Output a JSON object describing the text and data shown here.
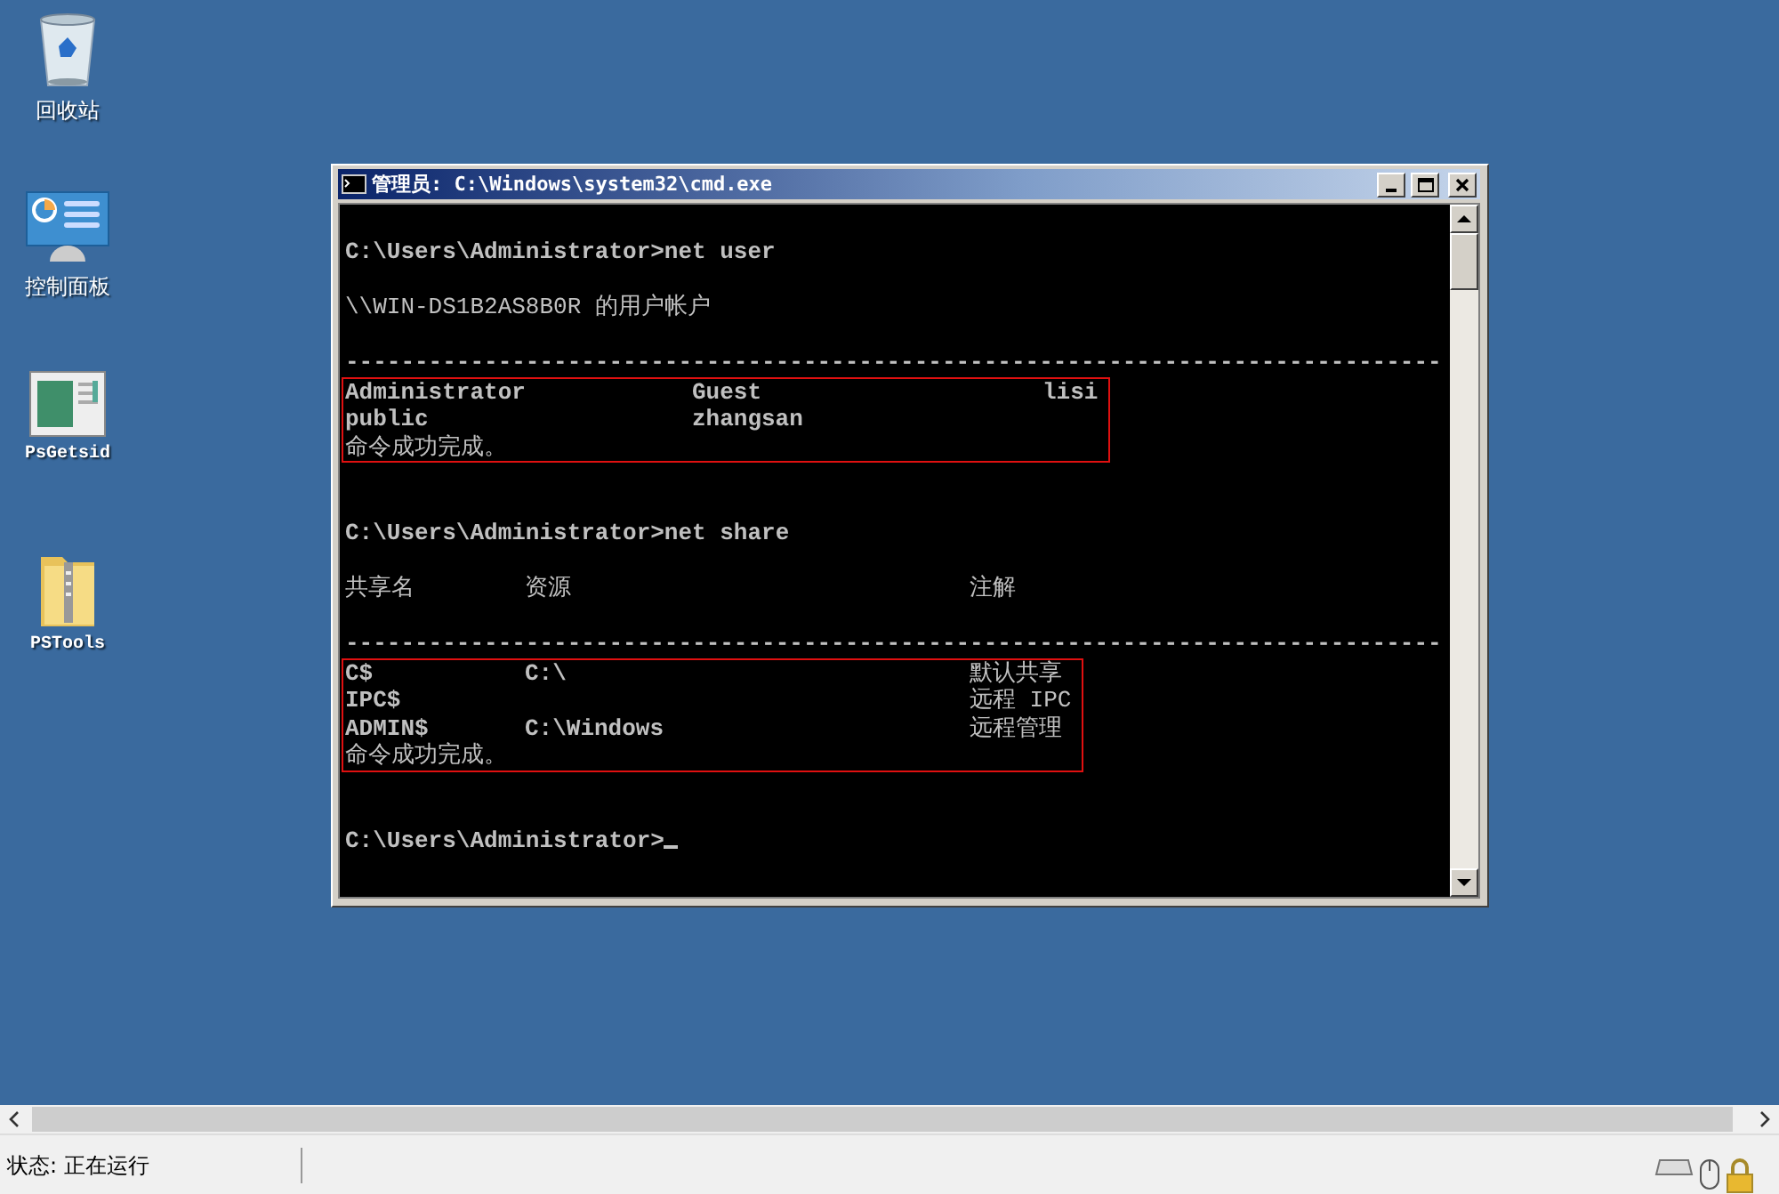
{
  "desktop_icons": [
    {
      "kind": "recycle-bin",
      "label": "回收站"
    },
    {
      "kind": "control-panel",
      "label": "控制面板"
    },
    {
      "kind": "app-window",
      "label": "PsGetsid"
    },
    {
      "kind": "zip-folder",
      "label": "PSTools"
    }
  ],
  "window": {
    "title": "管理员: C:\\Windows\\system32\\cmd.exe",
    "console": [
      {
        "kind": "blank"
      },
      {
        "kind": "line",
        "text": "C:\\Users\\Administrator>net user"
      },
      {
        "kind": "blank"
      },
      {
        "kind": "line",
        "text": "\\\\WIN-DS1B2AS8B0R 的用户帐户"
      },
      {
        "kind": "blank"
      },
      {
        "kind": "rule",
        "text": "-------------------------------------------------------------------------------"
      },
      {
        "kind": "user-list",
        "rows": [
          [
            "Administrator",
            "Guest",
            "lisi"
          ],
          [
            "public",
            "zhangsan",
            null
          ]
        ],
        "footer": "命令成功完成。"
      },
      {
        "kind": "blank"
      },
      {
        "kind": "blank"
      },
      {
        "kind": "line",
        "text": "C:\\Users\\Administrator>net share"
      },
      {
        "kind": "blank"
      },
      {
        "kind": "share-header",
        "cells": [
          "共享名",
          "资源",
          "注解"
        ]
      },
      {
        "kind": "blank"
      },
      {
        "kind": "rule",
        "text": "-------------------------------------------------------------------------------"
      },
      {
        "kind": "share-list",
        "rows": [
          [
            "C$",
            "C:\\",
            "默认共享"
          ],
          [
            "IPC$",
            null,
            "远程 IPC"
          ],
          [
            "ADMIN$",
            "C:\\Windows",
            "远程管理"
          ]
        ],
        "footer": "命令成功完成。"
      },
      {
        "kind": "blank"
      },
      {
        "kind": "blank"
      },
      {
        "kind": "prompt",
        "text": "C:\\Users\\Administrator>"
      }
    ]
  },
  "status_bar": {
    "text": "状态: 正在运行"
  }
}
